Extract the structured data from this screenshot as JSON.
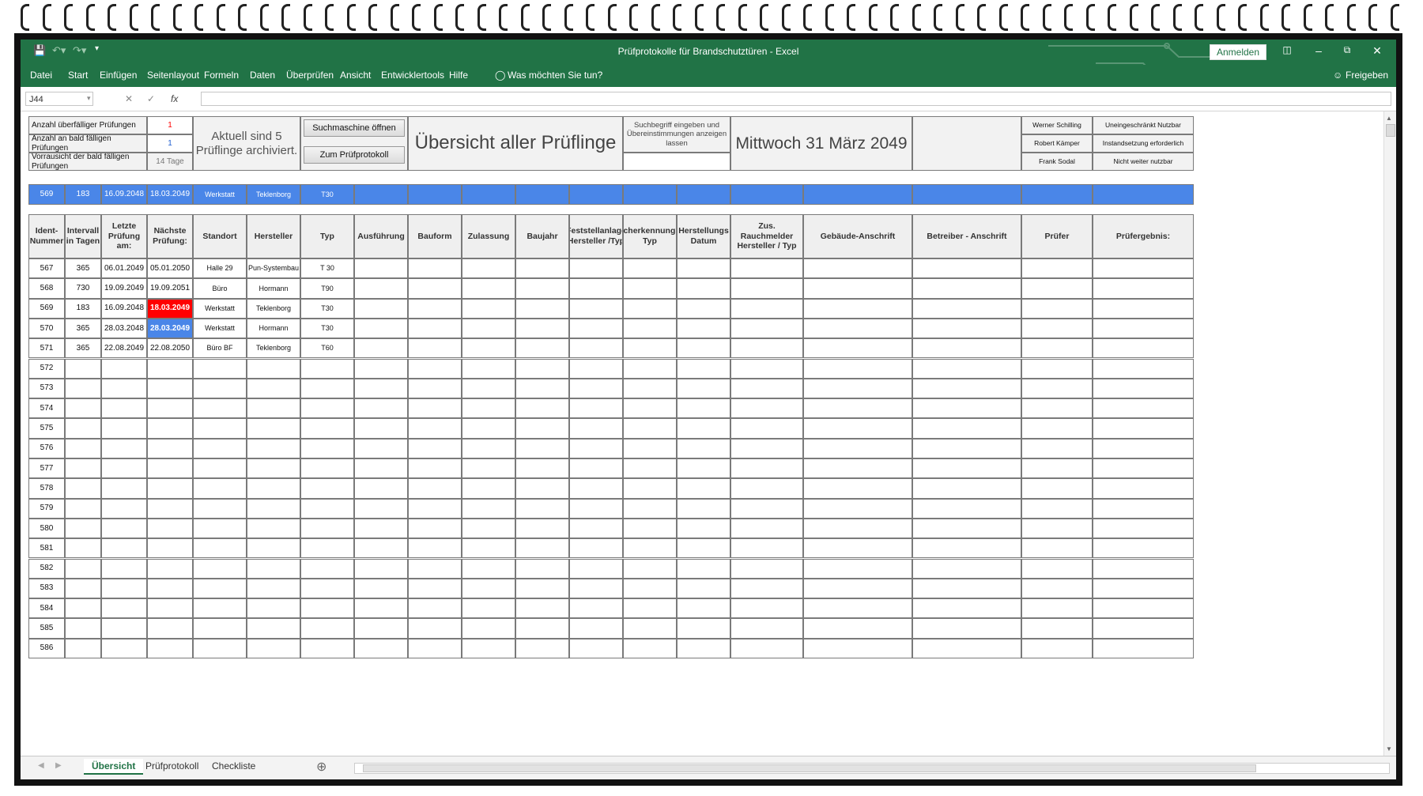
{
  "app": {
    "title": "Prüfprotokolle für Brandschutztüren  -  Excel",
    "signin": "Anmelden",
    "share": "Freigeben",
    "tell_me": "Was möchten Sie tun?",
    "menu": [
      "Datei",
      "Start",
      "Einfügen",
      "Seitenlayout",
      "Formeln",
      "Daten",
      "Überprüfen",
      "Ansicht",
      "Entwicklertools",
      "Hilfe"
    ]
  },
  "formula_bar": {
    "name_box": "J44",
    "fx": "fx",
    "content": ""
  },
  "summary": {
    "overdue_label": "Anzahl überfälliger Prüfungen",
    "overdue_value": "1",
    "soon_label": "Anzahl an bald fälligen Prüfungen",
    "soon_value": "1",
    "preview_label": "Vorrausicht der bald fälligen Prüfungen",
    "preview_value": "14 Tage",
    "archived": "Aktuell sind 5 Prüflinge archiviert.",
    "btn_search": "Suchmaschine öffnen",
    "btn_protocol": "Zum Prüfprotokoll",
    "main_title": "Übersicht aller Prüflinge",
    "search_hint": "Suchbegriff eingeben und Übereinstimmungen anzeigen lassen",
    "date": "Mittwoch 31 März 2049",
    "people": [
      "Werner Schilling",
      "Robert Kämper",
      "Frank Sodal"
    ],
    "status": [
      "Uneingeschränkt Nutzbar",
      "Instandsetzung erforderlich",
      "Nicht weiter nutzbar"
    ]
  },
  "search_row": [
    "569",
    "183",
    "16.09.2048",
    "18.03.2049",
    "Werkstatt",
    "Teklenborg",
    "T30"
  ],
  "columns": [
    "Ident-Nummer",
    "Intervall in Tagen",
    "Letzte Prüfung am:",
    "Nächste Prüfung:",
    "Standort",
    "Hersteller",
    "Typ",
    "Ausführung",
    "Bauform",
    "Zulassung",
    "Baujahr",
    "Feststellanlage Hersteller /Typ",
    "Raucherkennungsteil Typ",
    "Herstellungs Datum",
    "Zus. Rauchmelder Hersteller / Typ",
    "Gebäude-Anschrift",
    "Betreiber - Anschrift",
    "Prüfer",
    "Prüfergebnis:"
  ],
  "rows": [
    [
      "567",
      "365",
      "06.01.2049",
      "05.01.2050",
      "Halle 29",
      "Pun-Systembau",
      "T 30"
    ],
    [
      "568",
      "730",
      "19.09.2049",
      "19.09.2051",
      "Büro",
      "Hormann",
      "T90"
    ],
    [
      "569",
      "183",
      "16.09.2048",
      "18.03.2049",
      "Werkstatt",
      "Teklenborg",
      "T30"
    ],
    [
      "570",
      "365",
      "28.03.2048",
      "28.03.2049",
      "Werkstatt",
      "Hormann",
      "T30"
    ],
    [
      "571",
      "365",
      "22.08.2049",
      "22.08.2050",
      "Büro BF",
      "Teklenborg",
      "T60"
    ],
    [
      "572"
    ],
    [
      "573"
    ],
    [
      "574"
    ],
    [
      "575"
    ],
    [
      "576"
    ],
    [
      "577"
    ],
    [
      "578"
    ],
    [
      "579"
    ],
    [
      "580"
    ],
    [
      "581"
    ],
    [
      "582"
    ],
    [
      "583"
    ],
    [
      "584"
    ],
    [
      "585"
    ],
    [
      "586"
    ]
  ],
  "highlight": {
    "overdue_row": 2,
    "soon_row": 3
  },
  "colors": {
    "excel_green": "#217346",
    "overdue": "#ff0000",
    "soon": "#4a86e8"
  },
  "sheet_tabs": [
    "Übersicht",
    "Prüfprotokoll",
    "Checkliste"
  ],
  "active_tab": 0
}
